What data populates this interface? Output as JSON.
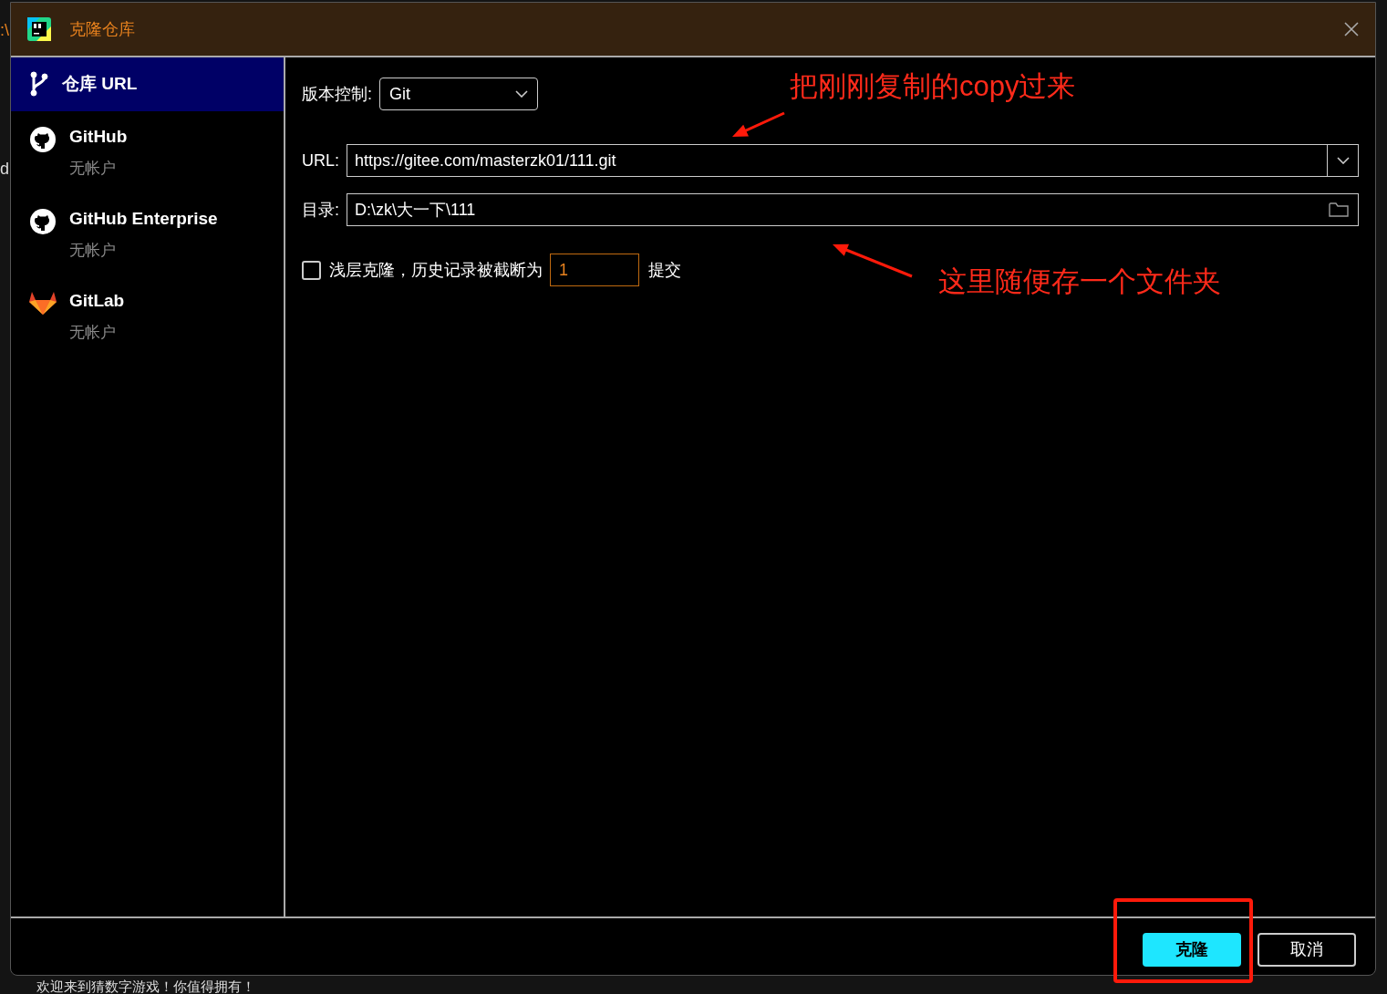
{
  "background": {
    "edge_texts": [
      ":\\",
      "d"
    ],
    "footer_text": "欢迎来到猜数字游戏！你值得拥有！"
  },
  "window": {
    "title": "克隆仓库"
  },
  "sidebar": {
    "items": [
      {
        "label": "仓库 URL",
        "kind": "url",
        "selected": true
      },
      {
        "label": "GitHub",
        "sub": "无帐户",
        "kind": "github",
        "selected": false
      },
      {
        "label": "GitHub Enterprise",
        "sub": "无帐户",
        "kind": "github",
        "selected": false
      },
      {
        "label": "GitLab",
        "sub": "无帐户",
        "kind": "gitlab",
        "selected": false
      }
    ]
  },
  "form": {
    "vcs": {
      "label": "版本控制:",
      "value": "Git"
    },
    "url": {
      "label": "URL:",
      "value": "https://gitee.com/masterzk01/111.git"
    },
    "directory": {
      "label": "目录:",
      "value": "D:\\zk\\大一下\\111"
    },
    "shallow": {
      "checked": false,
      "label": "浅层克隆，历史记录被截断为",
      "depth": "1",
      "suffix": "提交"
    }
  },
  "buttons": [
    {
      "label": "克隆",
      "kind": "primary"
    },
    {
      "label": "取消",
      "kind": "secondary"
    }
  ],
  "annotations": [
    {
      "kind": "note",
      "text": "把刚刚复制的copy过来"
    },
    {
      "kind": "arrow"
    },
    {
      "kind": "arrow"
    },
    {
      "kind": "note",
      "text": "这里随便存一个文件夹"
    },
    {
      "kind": "highlight"
    }
  ]
}
